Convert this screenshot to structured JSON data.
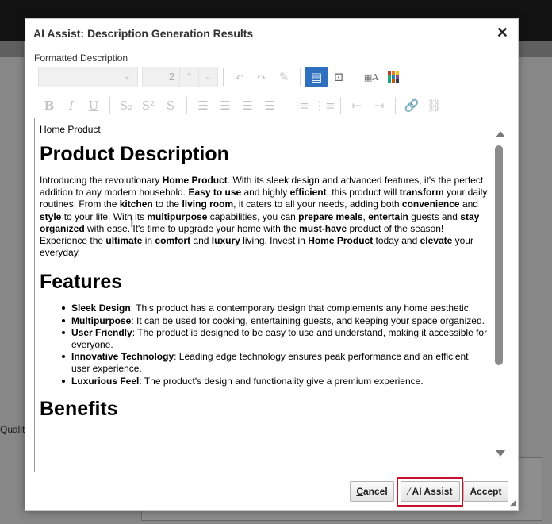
{
  "background": {
    "partial_label": "Qualit"
  },
  "dialog": {
    "title": "AI Assist: Description Generation Results",
    "close_label": "✕",
    "field_label": "Formatted Description"
  },
  "toolbar": {
    "font_size_value": "2",
    "row1_icons": [
      "undo-icon",
      "redo-icon",
      "clear-format-icon",
      "wysiwyg-mode-icon",
      "source-mode-icon",
      "text-color-icon",
      "background-color-icon"
    ],
    "row2_icons": [
      "bold-icon",
      "italic-icon",
      "underline-icon",
      "subscript-icon",
      "superscript-icon",
      "strikethrough-icon",
      "align-left-icon",
      "align-center-icon",
      "align-right-icon",
      "justify-icon",
      "bullet-list-icon",
      "numbered-list-icon",
      "outdent-icon",
      "indent-icon",
      "link-icon",
      "unlink-icon"
    ]
  },
  "document": {
    "title_line": "Home Product",
    "h1_description": "Product Description",
    "intro": [
      {
        "t": "Introducing the revolutionary "
      },
      {
        "b": "Home Product"
      },
      {
        "t": ". With its sleek design and advanced features, it's the perfect addition to any modern household. "
      },
      {
        "b": "Easy to use"
      },
      {
        "t": " and highly "
      },
      {
        "b": "efficient"
      },
      {
        "t": ", this product will "
      },
      {
        "b": "transform"
      },
      {
        "t": " your daily routines. From the "
      },
      {
        "b": "kitchen"
      },
      {
        "t": " to the "
      },
      {
        "b": "living room"
      },
      {
        "t": ", it caters to all your needs, adding both "
      },
      {
        "b": "convenience"
      },
      {
        "t": " and "
      },
      {
        "b": "style"
      },
      {
        "t": " to your life. With its "
      },
      {
        "b": "multipurpose"
      },
      {
        "t": " capabilities, you can "
      },
      {
        "b": "prepare meals"
      },
      {
        "t": ", "
      },
      {
        "b": "entertain"
      },
      {
        "t": " guests and "
      },
      {
        "b": "stay organized"
      },
      {
        "t": " with ease. It's time to upgrade your home with the "
      },
      {
        "b": "must-have"
      },
      {
        "t": " product of the season! Experience the "
      },
      {
        "b": "ultimate"
      },
      {
        "t": " in "
      },
      {
        "b": "comfort"
      },
      {
        "t": " and "
      },
      {
        "b": "luxury"
      },
      {
        "t": " living. Invest in "
      },
      {
        "b": "Home Product"
      },
      {
        "t": " today and "
      },
      {
        "b": "elevate"
      },
      {
        "t": " your everyday."
      }
    ],
    "h1_features": "Features",
    "features": [
      {
        "name": "Sleek Design",
        "text": ": This product has a contemporary design that complements any home aesthetic."
      },
      {
        "name": "Multipurpose",
        "text": ": It can be used for cooking, entertaining guests, and keeping your space organized."
      },
      {
        "name": "User Friendly",
        "text": ": The product is designed to be easy to use and understand, making it accessible for everyone."
      },
      {
        "name": "Innovative Technology",
        "text": ": Leading edge technology ensures peak performance and an efficient user experience."
      },
      {
        "name": "Luxurious Feel",
        "text": ": The product's design and functionality give a premium experience."
      }
    ],
    "h1_benefits": "Benefits"
  },
  "footer": {
    "cancel_first": "C",
    "cancel_rest": "ancel",
    "ai_assist_label": "AI Assist",
    "accept_label": "Accept"
  },
  "colors": {
    "active_toolbar": "#2e6fbe",
    "highlight_border": "#c8102e"
  }
}
